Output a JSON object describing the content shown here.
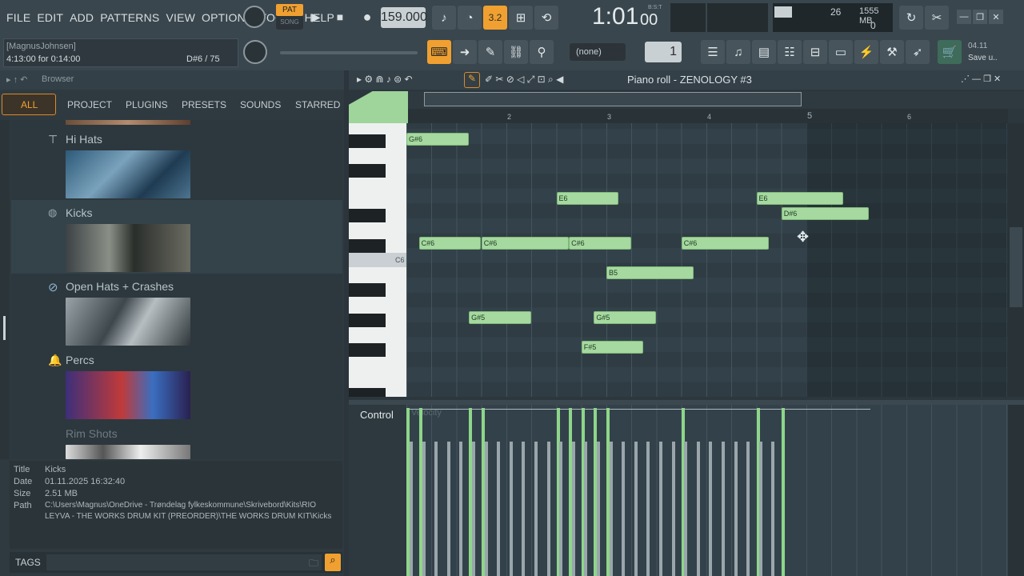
{
  "menu": [
    "FILE",
    "EDIT",
    "ADD",
    "PATTERNS",
    "VIEW",
    "OPTIONS",
    "TOOLS",
    "HELP"
  ],
  "transport": {
    "pat": "PAT",
    "song": "SONG",
    "tempo": "159.000",
    "time": "1:01",
    "time_small": "00",
    "bst": "B:S:T",
    "cpu": "26",
    "mem": "1555 MB",
    "poly": "0",
    "step": "3.2"
  },
  "hint": {
    "user": "[MagnusJohnsen]",
    "session": "4:13:00 for 0:14:00",
    "note": "D#6 / 75"
  },
  "toolbar": {
    "pattern": "(none)",
    "pattern_num": "1",
    "news_date": "04.11",
    "news_text": "Save u.."
  },
  "browser": {
    "title": "Browser",
    "tabs": [
      "ALL",
      "PROJECT",
      "PLUGINS",
      "PRESETS",
      "SOUNDS",
      "STARRED"
    ],
    "folders": [
      {
        "name": "Hi Hats",
        "color": "#b7c3c8"
      },
      {
        "name": "Kicks",
        "color": "#b7c3c8"
      },
      {
        "name": "Open Hats + Crashes",
        "color": "#b7c3c8"
      },
      {
        "name": "Percs",
        "color": "#b7c3c8"
      },
      {
        "name": "Rim Shots",
        "color": "#6e7a80"
      }
    ],
    "info": {
      "title_label": "Title",
      "title": "Kicks",
      "date_label": "Date",
      "date": "01.11.2025 16:32:40",
      "size_label": "Size",
      "size": "2.51 MB",
      "path_label": "Path",
      "path1": "C:\\Users\\Magnus\\OneDrive - Trøndelag fylkeskommune\\Skrivebord\\Kits\\RIO",
      "path2": "LEYVA - THE WORKS DRUM KIT (PREORDER)\\THE WORKS DRUM KIT\\Kicks"
    },
    "tags": "TAGS"
  },
  "pianoroll": {
    "title": "Piano roll - ZENOLOGY #3",
    "c6": "C6",
    "control": "Control",
    "control_sub": "Velocity",
    "bars": [
      "2",
      "3",
      "4",
      "5",
      "6"
    ],
    "notes": [
      {
        "n": "G#6",
        "bar": 1.0,
        "len": 0.62,
        "row": 0
      },
      {
        "n": "E6",
        "bar": 2.5,
        "len": 0.62,
        "row": 4
      },
      {
        "n": "E6",
        "bar": 4.5,
        "len": 0.87,
        "row": 4
      },
      {
        "n": "D#6",
        "bar": 4.75,
        "len": 0.87,
        "row": 5
      },
      {
        "n": "C#6",
        "bar": 1.125,
        "len": 0.62,
        "row": 7
      },
      {
        "n": "C#6",
        "bar": 1.75,
        "len": 0.87,
        "row": 7
      },
      {
        "n": "C#6",
        "bar": 2.625,
        "len": 0.62,
        "row": 7
      },
      {
        "n": "C#6",
        "bar": 3.75,
        "len": 0.87,
        "row": 7
      },
      {
        "n": "B5",
        "bar": 3.0,
        "len": 0.87,
        "row": 9
      },
      {
        "n": "G#5",
        "bar": 1.625,
        "len": 0.62,
        "row": 12
      },
      {
        "n": "G#5",
        "bar": 2.875,
        "len": 0.62,
        "row": 12
      },
      {
        "n": "F#5",
        "bar": 2.75,
        "len": 0.62,
        "row": 14
      }
    ]
  }
}
